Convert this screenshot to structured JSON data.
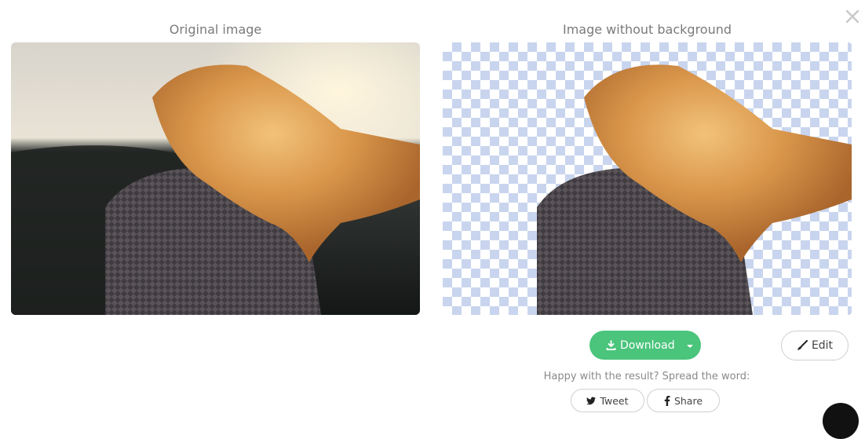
{
  "original": {
    "title": "Original image"
  },
  "result": {
    "title": "Image without background"
  },
  "actions": {
    "download_label": "Download",
    "edit_label": "Edit"
  },
  "share": {
    "prompt": "Happy with the result? Spread the word:",
    "tweet_label": "Tweet",
    "share_label": "Share"
  },
  "icons": {
    "close": "close-icon",
    "download": "download-icon",
    "dropdown": "chevron-down-icon",
    "edit": "brush-icon",
    "tweet": "twitter-icon",
    "share": "facebook-icon",
    "chat": "chat-icon"
  },
  "colors": {
    "download_button": "#4bc47c",
    "checker": "#c9d5ee"
  }
}
